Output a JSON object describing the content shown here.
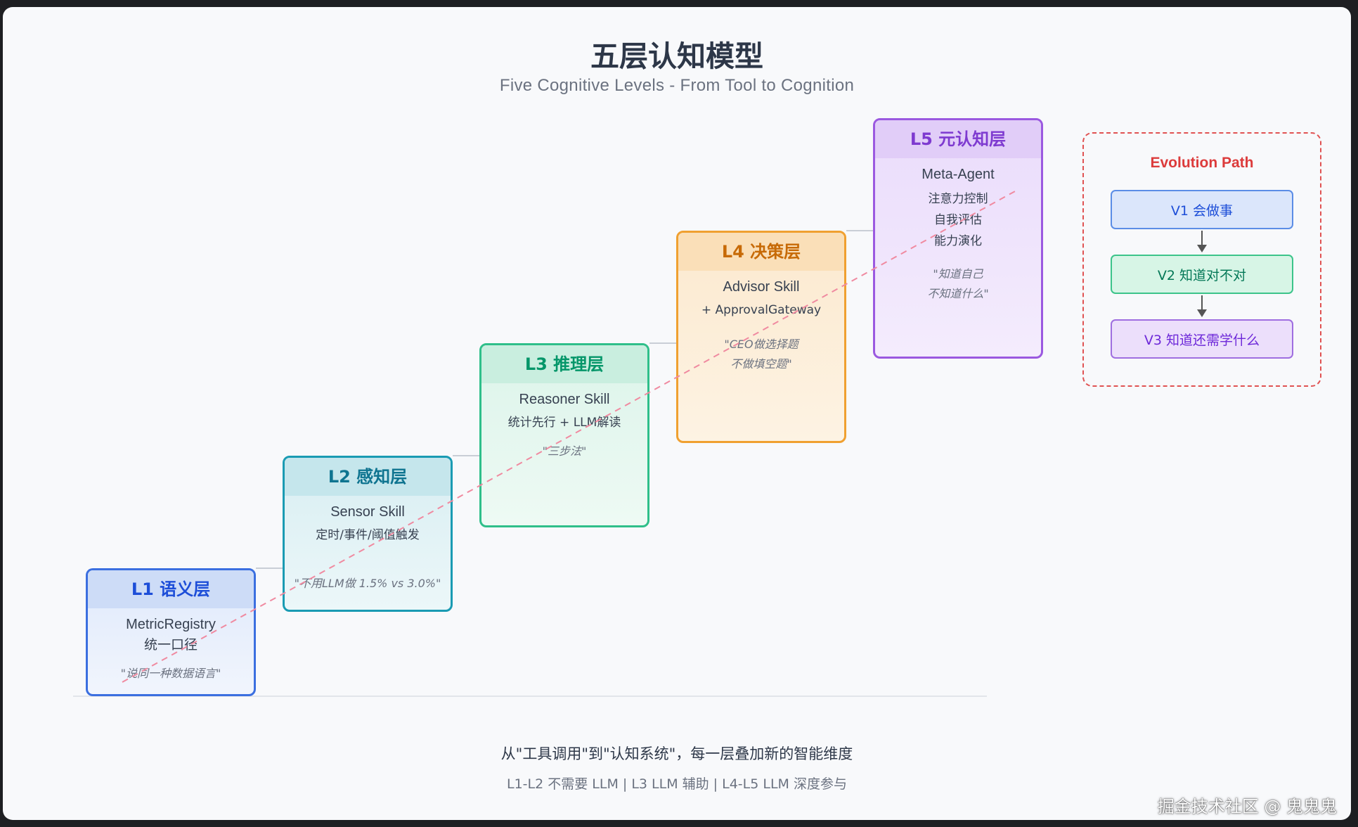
{
  "title": "五层认知模型",
  "subtitle": "Five Cognitive Levels - From Tool to Cognition",
  "levels": [
    {
      "header": "L1 语义层",
      "line1": "MetricRegistry",
      "line2": "统一口径",
      "line3": "",
      "quote1": "\"说同一种数据语言\"",
      "quote2": ""
    },
    {
      "header": "L2 感知层",
      "line1": "Sensor Skill",
      "line2": "定时/事件/阈值触发",
      "line3": "",
      "quote1": "\"不用LLM做 1.5% vs 3.0%\"",
      "quote2": ""
    },
    {
      "header": "L3 推理层",
      "line1": "Reasoner Skill",
      "line2": "统计先行 + LLM解读",
      "line3": "",
      "quote1": "\"三步法\"",
      "quote2": ""
    },
    {
      "header": "L4 决策层",
      "line1": "Advisor Skill",
      "line2": "+ ApprovalGateway",
      "line3": "",
      "quote1": "\"CEO做选择题",
      "quote2": "不做填空题\""
    },
    {
      "header": "L5 元认知层",
      "line1": "Meta-Agent",
      "line2": "注意力控制",
      "line3": "自我评估",
      "line4": "能力演化",
      "quote1": "\"知道自己",
      "quote2": "不知道什么\""
    }
  ],
  "evolution": {
    "title": "Evolution Path",
    "steps": [
      "V1 会做事",
      "V2 知道对不对",
      "V3 知道还需学什么"
    ]
  },
  "footer": {
    "main": "从\"工具调用\"到\"认知系统\"，每一层叠加新的智能维度",
    "sub": "L1-L2 不需要 LLM | L3 LLM 辅助 | L4-L5 LLM 深度参与"
  },
  "watermark": "掘金技术社区 @ 鬼鬼鬼",
  "colors": {
    "l1": "#3b6fe0",
    "l2": "#1a9bb3",
    "l3": "#2fbf8a",
    "l4": "#f0a030",
    "l5": "#9b59e0",
    "evolution": "#e05252"
  }
}
